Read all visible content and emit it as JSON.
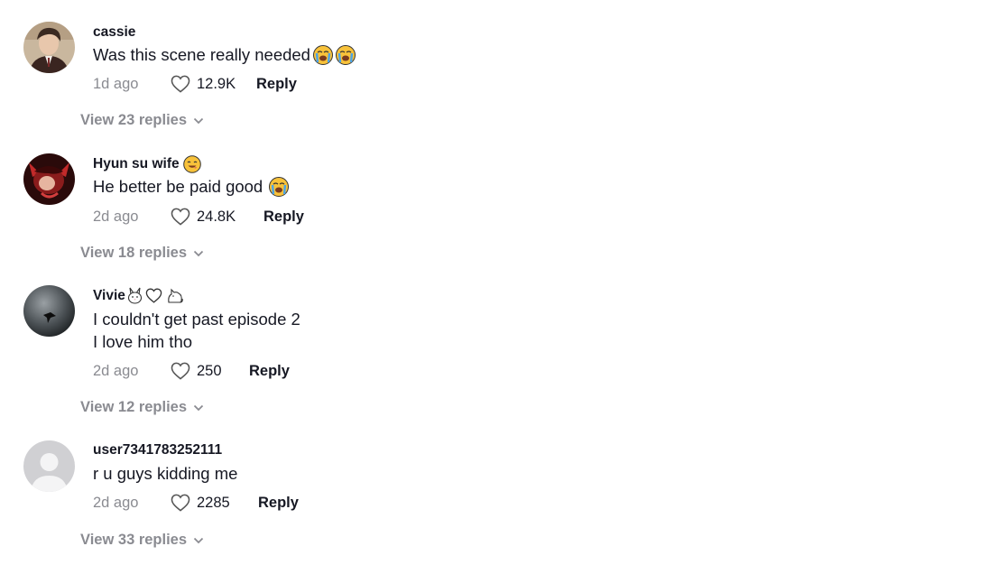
{
  "comments": [
    {
      "username": "cassie",
      "lines": [
        "Was this scene really needed"
      ],
      "time": "1d ago",
      "likes": "12.9K",
      "reply_label": "Reply",
      "view_replies": "View 23 replies",
      "avatar": "profile-photo-person"
    },
    {
      "username": "Hyun su wife",
      "lines": [
        "He better be paid good"
      ],
      "time": "2d ago",
      "likes": "24.8K",
      "reply_label": "Reply",
      "view_replies": "View 18 replies",
      "avatar": "profile-photo-red-art"
    },
    {
      "username": "Vivie",
      "lines": [
        "I couldn't get past episode 2",
        "I love him tho"
      ],
      "time": "2d ago",
      "likes": "250",
      "reply_label": "Reply",
      "view_replies": "View 12 replies",
      "avatar": "profile-photo-dark"
    },
    {
      "username": "user7341783252111",
      "lines": [
        "r u guys kidding me"
      ],
      "time": "2d ago",
      "likes": "2285",
      "reply_label": "Reply",
      "view_replies": "View 33 replies",
      "avatar": "default-avatar"
    }
  ],
  "icons": {
    "like": "heart-outline-icon",
    "expand": "chevron-down-icon",
    "crying": "loudly-crying-face-emoji",
    "smile": "smiling-face-emoji",
    "rabbit": "rabbit-face-emoji",
    "heart": "white-heart-emoji",
    "cat": "cat-outline-emoji"
  },
  "colors": {
    "text": "#161823",
    "secondary": "#8a8b91",
    "emoji_yellow": "#f8c23a"
  }
}
